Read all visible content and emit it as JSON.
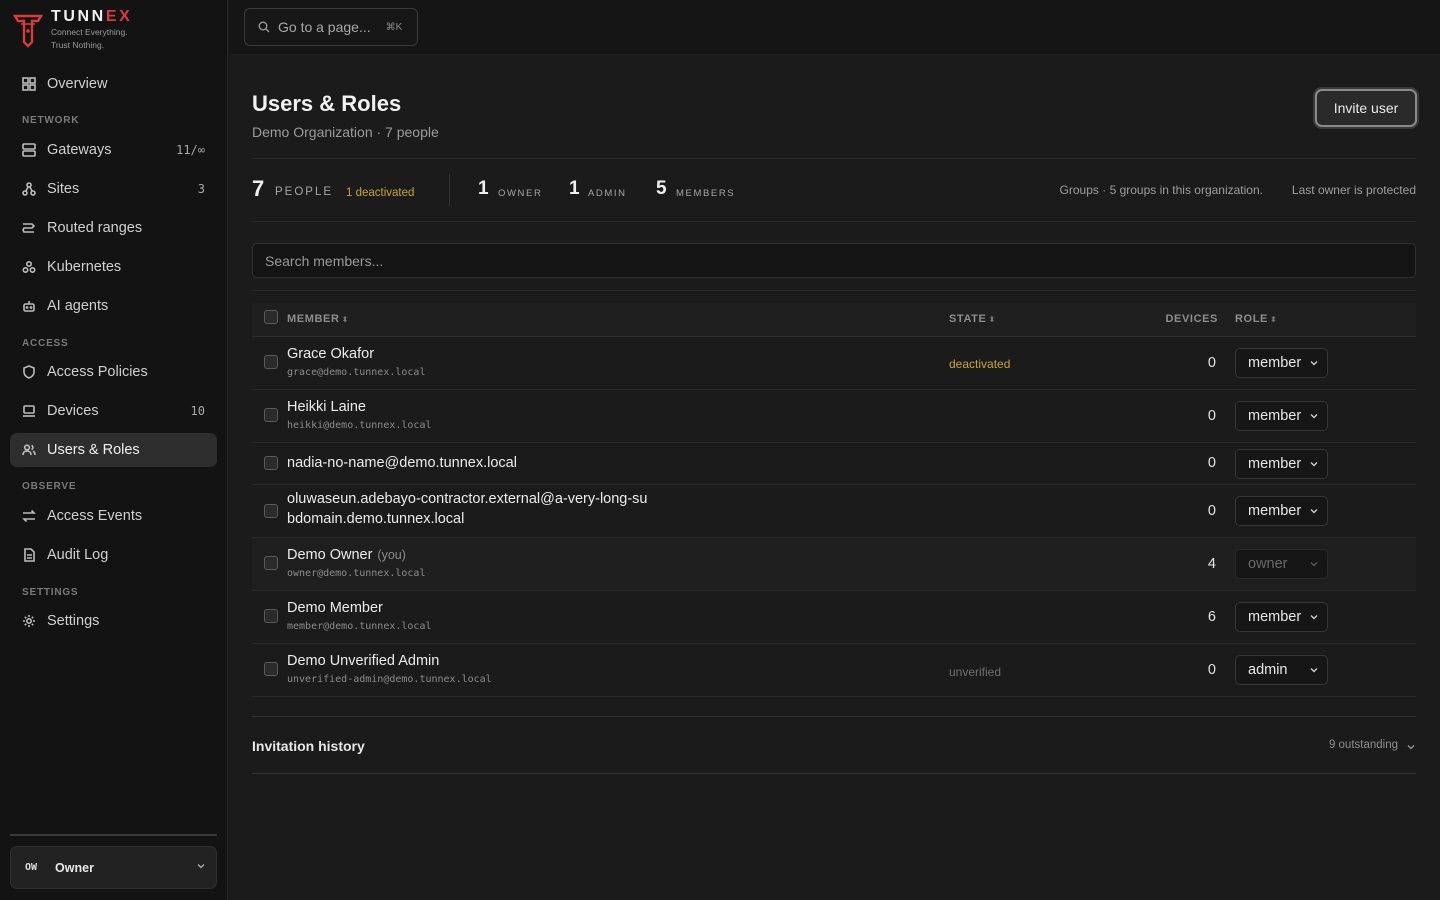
{
  "brand": {
    "name_pre": "TUNN",
    "name_ex": "EX",
    "tagline_1": "Connect Everything.",
    "tagline_2": "Trust Nothing."
  },
  "topbar": {
    "goto_placeholder": "Go to a page...",
    "goto_shortcut": "⌘K"
  },
  "sidebar": {
    "sections": [
      "NETWORK",
      "ACCESS",
      "OBSERVE",
      "SETTINGS"
    ],
    "items": [
      {
        "label": "Overview",
        "icon": "grid-icon",
        "badge": ""
      },
      {
        "label": "Gateways",
        "icon": "server-icon",
        "badge": "11/∞"
      },
      {
        "label": "Sites",
        "icon": "sites-icon",
        "badge": "3"
      },
      {
        "label": "Routed ranges",
        "icon": "route-icon",
        "badge": ""
      },
      {
        "label": "Kubernetes",
        "icon": "kubernetes-icon",
        "badge": ""
      },
      {
        "label": "AI agents",
        "icon": "bot-icon",
        "badge": ""
      },
      {
        "label": "Access Policies",
        "icon": "shield-icon",
        "badge": ""
      },
      {
        "label": "Devices",
        "icon": "laptop-icon",
        "badge": "10"
      },
      {
        "label": "Users & Roles",
        "icon": "users-icon",
        "badge": ""
      },
      {
        "label": "Access Events",
        "icon": "arrows-icon",
        "badge": ""
      },
      {
        "label": "Audit Log",
        "icon": "file-icon",
        "badge": ""
      },
      {
        "label": "Settings",
        "icon": "gear-icon",
        "badge": ""
      }
    ],
    "active": "Users & Roles",
    "user": {
      "initials": "OW",
      "name": "Owner"
    }
  },
  "page": {
    "title": "Users & Roles",
    "subtitle": "Demo Organization · 7 people",
    "invite_label": "Invite user"
  },
  "stats": {
    "people_count": "7",
    "people_label": "PEOPLE",
    "deactivated": "1 deactivated",
    "owner_count": "1",
    "owner_label": "OWNER",
    "admin_count": "1",
    "admin_label": "ADMIN",
    "members_count": "5",
    "members_label": "MEMBERS",
    "groups_text": "Groups · 5 groups in this organization.",
    "protected_text": "Last owner is protected"
  },
  "search": {
    "placeholder": "Search members..."
  },
  "table": {
    "headers": {
      "member": "MEMBER",
      "state": "STATE",
      "devices": "DEVICES",
      "role": "ROLE"
    },
    "sort_glyph": "⬍",
    "rows": [
      {
        "name": "Grace Okafor",
        "you": "",
        "email": "grace@demo.tunnex.local",
        "state": "deactivated",
        "devices": "0",
        "role": "member"
      },
      {
        "name": "Heikki Laine",
        "you": "",
        "email": "heikki@demo.tunnex.local",
        "state": "",
        "devices": "0",
        "role": "member"
      },
      {
        "name": "nadia-no-name@demo.tunnex.local",
        "you": "",
        "email": "",
        "state": "",
        "devices": "0",
        "role": "member"
      },
      {
        "name": "oluwaseun.adebayo-contractor.external@a-very-long-su",
        "name2": "bdomain.demo.tunnex.local",
        "you": "",
        "email": "",
        "state": "",
        "devices": "0",
        "role": "member"
      },
      {
        "name": "Demo Owner",
        "you": "(you)",
        "email": "owner@demo.tunnex.local",
        "state": "",
        "devices": "4",
        "role": "owner"
      },
      {
        "name": "Demo Member",
        "you": "",
        "email": "member@demo.tunnex.local",
        "state": "",
        "devices": "6",
        "role": "member"
      },
      {
        "name": "Demo Unverified Admin",
        "you": "",
        "email": "unverified-admin@demo.tunnex.local",
        "state": "unverified",
        "devices": "0",
        "role": "admin"
      }
    ]
  },
  "invitations": {
    "title": "Invitation history",
    "outstanding": "9 outstanding"
  },
  "colors": {
    "warn": "#c9a23a",
    "unverified": "#6f6f6f",
    "brand_red": "#d93b3b"
  }
}
